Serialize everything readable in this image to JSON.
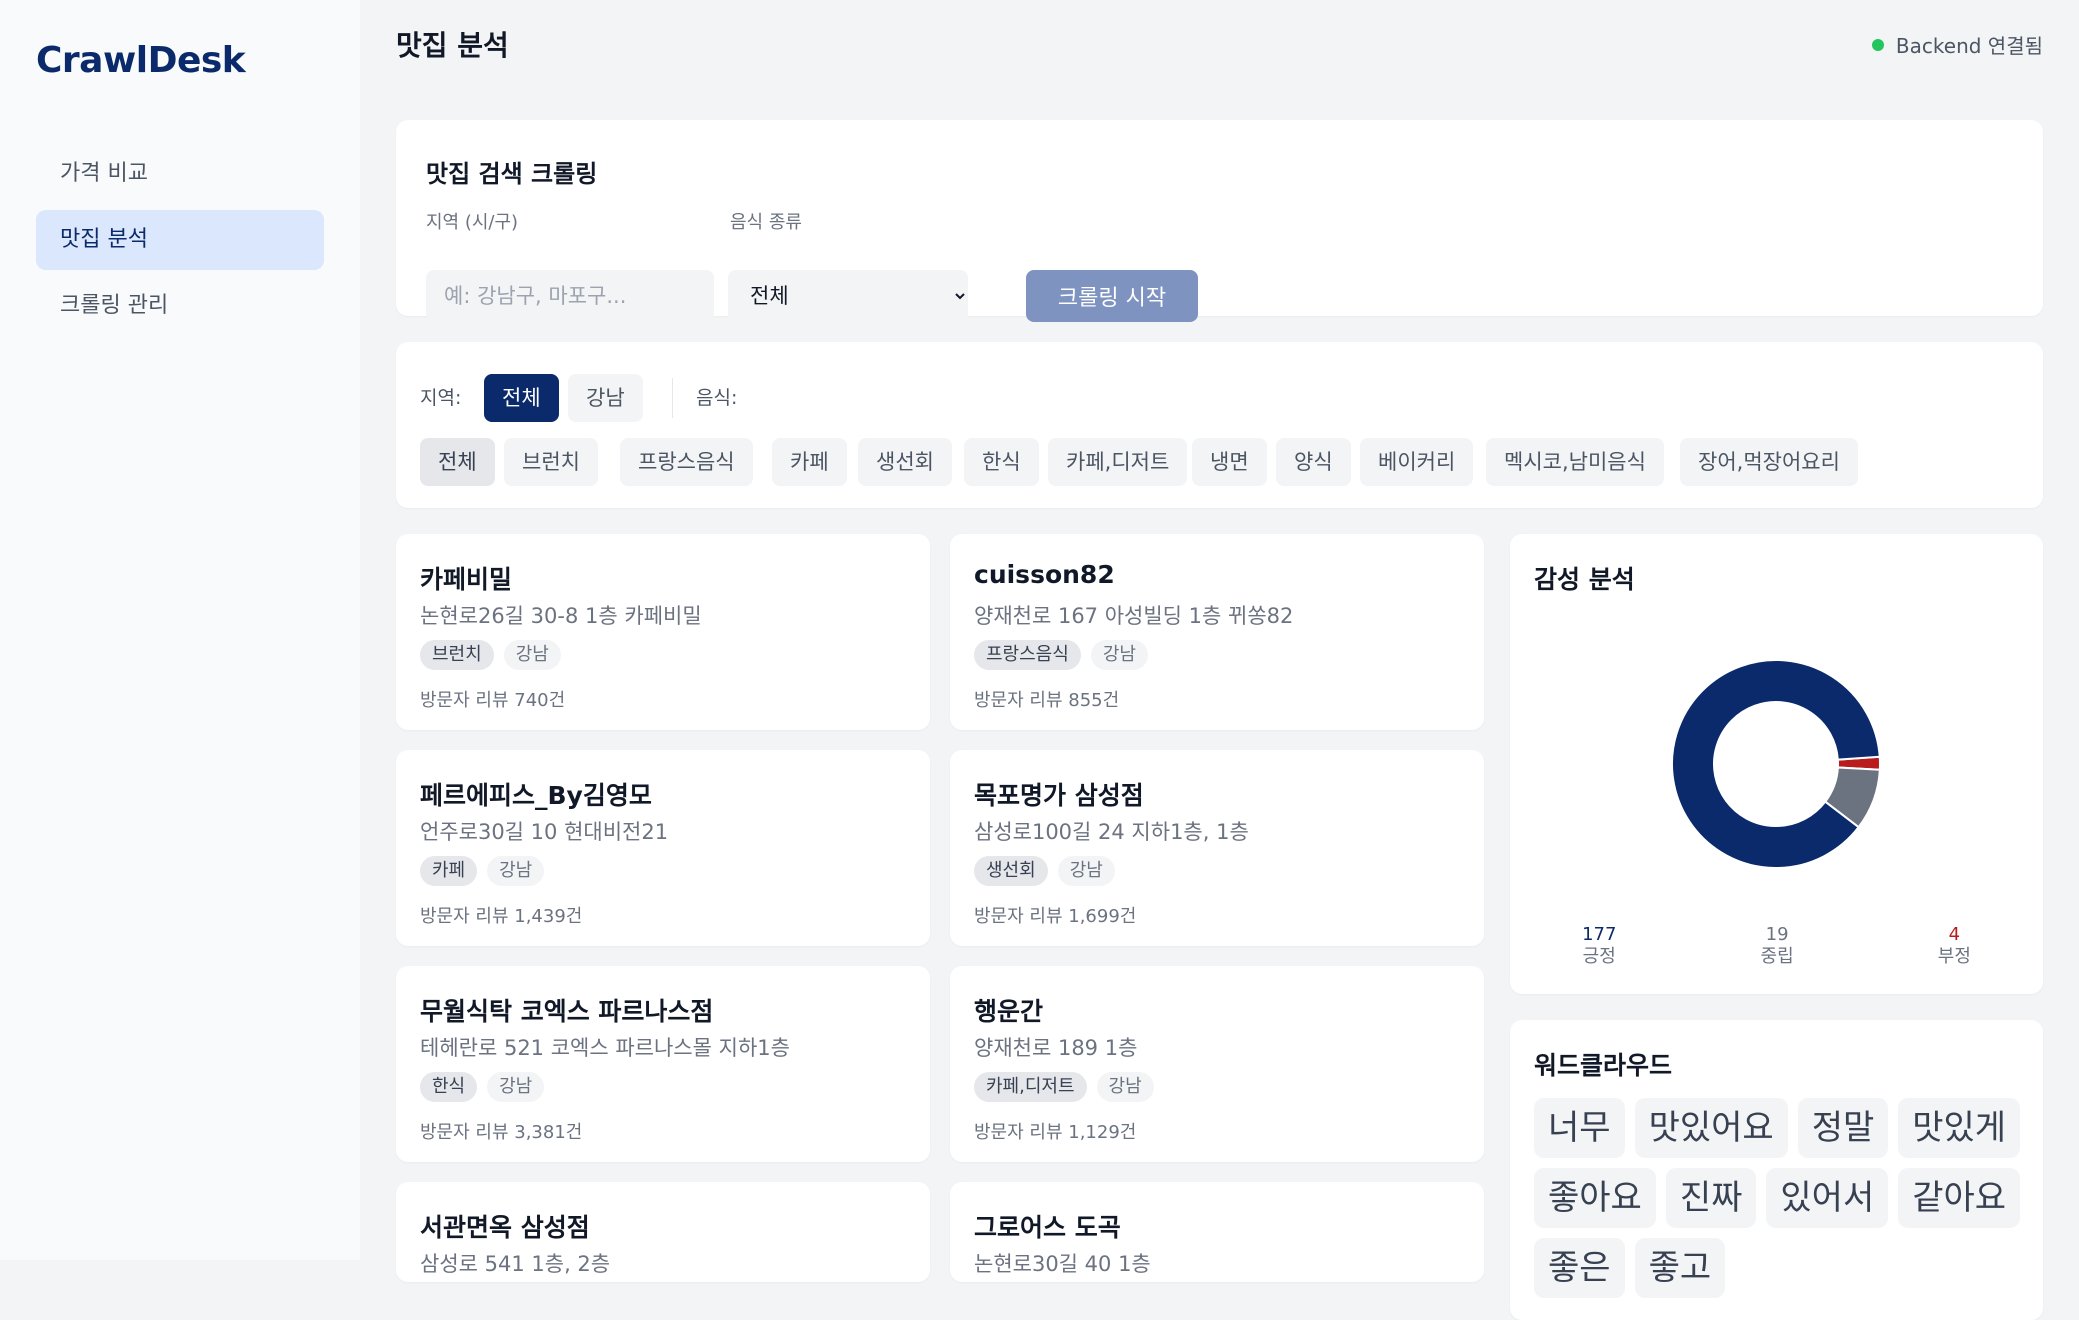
{
  "app": {
    "name": "CrawlDesk"
  },
  "sidebar": {
    "items": [
      {
        "label": "가격 비교"
      },
      {
        "label": "맛집 분석"
      },
      {
        "label": "크롤링 관리"
      }
    ]
  },
  "header": {
    "title": "맛집 분석",
    "status_text": "Backend 연결됨",
    "status_color": "#22c55e"
  },
  "crawl_form": {
    "title": "맛집 검색 크롤링",
    "region_label": "지역 (시/구)",
    "region_placeholder": "예: 강남구, 마포구...",
    "food_label": "음식 종류",
    "food_selected": "전체",
    "start_button": "크롤링 시작"
  },
  "filters": {
    "region_label": "지역:",
    "regions": [
      "전체",
      "강남"
    ],
    "food_label": "음식:",
    "foods": [
      "전체",
      "브런치",
      "프랑스음식",
      "카페",
      "생선회",
      "한식",
      "카페,디저트",
      "냉면",
      "양식",
      "베이커리",
      "멕시코,남미음식",
      "장어,먹장어요리"
    ]
  },
  "restaurants": [
    {
      "name": "카페비밀",
      "address": "논현로26길 30-8 1층 카페비밀",
      "category": "브런치",
      "area": "강남",
      "reviews": "방문자 리뷰 740건"
    },
    {
      "name": "cuisson82",
      "address": "양재천로 167 아성빌딩 1층 뀌쏭82",
      "category": "프랑스음식",
      "area": "강남",
      "reviews": "방문자 리뷰 855건"
    },
    {
      "name": "페르에피스_By김영모",
      "address": "언주로30길 10 현대비전21",
      "category": "카페",
      "area": "강남",
      "reviews": "방문자 리뷰 1,439건"
    },
    {
      "name": "목포명가 삼성점",
      "address": "삼성로100길 24 지하1층, 1층",
      "category": "생선회",
      "area": "강남",
      "reviews": "방문자 리뷰 1,699건"
    },
    {
      "name": "무월식탁 코엑스 파르나스점",
      "address": "테헤란로 521 코엑스 파르나스몰 지하1층",
      "category": "한식",
      "area": "강남",
      "reviews": "방문자 리뷰 3,381건"
    },
    {
      "name": "행운간",
      "address": "양재천로 189 1층",
      "category": "카페,디저트",
      "area": "강남",
      "reviews": "방문자 리뷰 1,129건"
    },
    {
      "name": "서관면옥 삼성점",
      "address": "삼성로 541 1층, 2층",
      "category": "",
      "area": "",
      "reviews": ""
    },
    {
      "name": "그로어스 도곡",
      "address": "논현로30길 40 1층",
      "category": "",
      "area": "",
      "reviews": ""
    }
  ],
  "sentiment": {
    "title": "감성 분석",
    "positive": {
      "value": 177,
      "label": "긍정",
      "color": "#0b2a6b"
    },
    "neutral": {
      "value": 19,
      "label": "중립",
      "color": "#6b7280"
    },
    "negative": {
      "value": 4,
      "label": "부정",
      "color": "#b91c1c"
    }
  },
  "chart_data": {
    "type": "pie",
    "categories": [
      "긍정",
      "중립",
      "부정"
    ],
    "values": [
      177,
      19,
      4
    ],
    "colors": [
      "#0b2a6b",
      "#6b7280",
      "#b91c1c"
    ],
    "title": "감성 분석"
  },
  "wordcloud": {
    "title": "워드클라우드",
    "words": [
      "너무",
      "맛있어요",
      "정말",
      "맛있게",
      "좋아요",
      "진짜",
      "있어서",
      "같아요",
      "좋은",
      "좋고"
    ]
  }
}
